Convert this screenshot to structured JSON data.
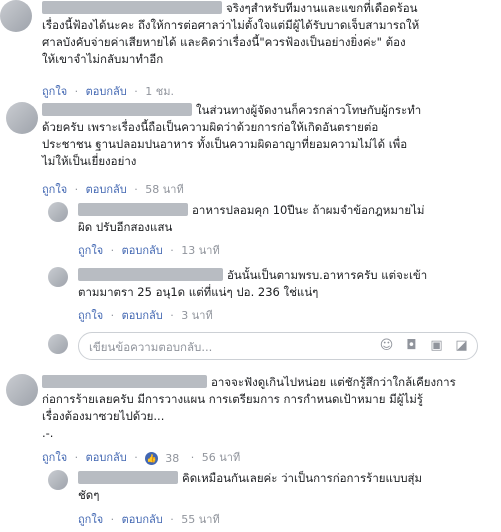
{
  "comments": [
    {
      "lines": [
        "จริงๆสำหรับทีมงานและแขกที่เดือดร้อน",
        "เรื่องนี้ฟ้องได้นะคะ ถึงให้การต่อศาลว่าไม่ตั้งใจแต่มีผู้ได้รับบาดเจ็บสามารถให้",
        "ศาลบังคับจ่ายค่าเสียหายได้ และคิดว่าเรื่องนี้\"ควรฟ้องเป็นอย่างยิ่งค่ะ\" ต้อง",
        "ให้เขาจำไม่กลับมาทำอีก"
      ],
      "like": "ถูกใจ",
      "reply": "ตอบกลับ",
      "time": "1 ชม."
    },
    {
      "lines": [
        "ในส่วนทางผู้จัดงานก็ควรกล่าวโทษกับผู้กระทำ",
        "ด้วยครับ เพราะเรื่องนี้ถือเป็นความผิดว่าด้วยการก่อให้เกิดอันตรายต่อ",
        "ประชาชน ฐานปลอมปนอาหาร ทั้งเป็นความผิดอาญาที่ยอมความไม่ได้ เพื่อ",
        "ไม่ให้เป็นเยี่ยงอย่าง"
      ],
      "like": "ถูกใจ",
      "reply": "ตอบกลับ",
      "time": "58 นาที"
    },
    {
      "lines": [
        "อาหารปลอมคุก 10ปีนะ ถ้าผมจำข้อกฎหมายไม่",
        "ผิด ปรับอีกสองแสน"
      ],
      "like": "ถูกใจ",
      "reply": "ตอบกลับ",
      "time": "13 นาที"
    },
    {
      "lines": [
        "อันนั้นเป็นตามพรบ.อาหารครับ แต่จะเข้า",
        "ตามมาตรา 25 อนุ1ด แต่ที่แน่ๆ ปอ. 236 ใช่แน่ๆ"
      ],
      "like": "ถูกใจ",
      "reply": "ตอบกลับ",
      "time": "3 นาที"
    },
    {
      "lines": [
        "อาจจะฟังดูเกินไปหน่อย แต่ชักรู้สึกว่าใกล้เคียงการ",
        "ก่อการร้ายเลยครับ มีการวางแผน การเตรียมการ การกำหนดเป้าหมาย มีผู้ไม่รู้",
        "เรื่องต้องมาซวยไปด้วย...",
        ".-."
      ],
      "like": "ถูกใจ",
      "reply": "ตอบกลับ",
      "reactions": "38",
      "time": "56 นาที"
    },
    {
      "lines": [
        "คิดเหมือนกันเลยค่ะ ว่าเป็นการก่อการร้ายแบบสุ่ม",
        "ชัดๆ"
      ],
      "like": "ถูกใจ",
      "reply": "ตอบกลับ",
      "time": "55 นาที"
    }
  ],
  "reply_box": {
    "placeholder": "เขียนข้อความตอบกลับ..."
  },
  "separator": "·"
}
